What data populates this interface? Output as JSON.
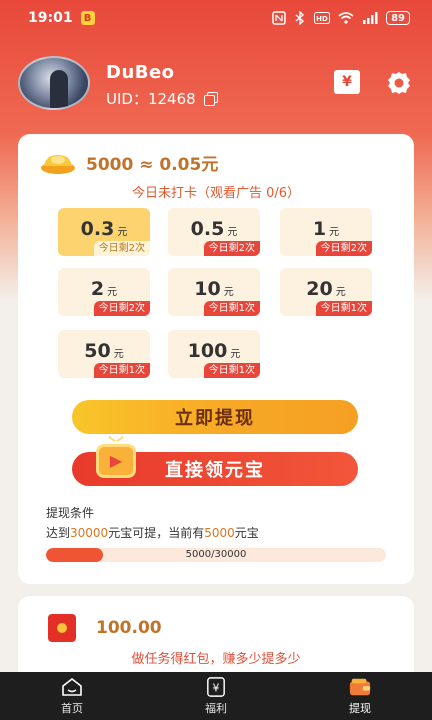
{
  "status_bar": {
    "time": "19:01",
    "notification_badge": "B",
    "battery": "89"
  },
  "profile": {
    "username": "DuBeo",
    "uid_label": "UID：",
    "uid_value": "12468"
  },
  "header_icons": {
    "wallet": "¥",
    "settings": "gear-icon"
  },
  "withdraw": {
    "rate": "5000 ≈ 0.05元",
    "checkin_status": "今日未打卡（观看广告 0/6）",
    "unit": "元",
    "options": [
      {
        "amount": "0.3",
        "remaining": "今日剩2次",
        "selected": true
      },
      {
        "amount": "0.5",
        "remaining": "今日剩2次",
        "selected": false
      },
      {
        "amount": "1",
        "remaining": "今日剩2次",
        "selected": false
      },
      {
        "amount": "2",
        "remaining": "今日剩2次",
        "selected": false
      },
      {
        "amount": "10",
        "remaining": "今日剩1次",
        "selected": false
      },
      {
        "amount": "20",
        "remaining": "今日剩1次",
        "selected": false
      },
      {
        "amount": "50",
        "remaining": "今日剩1次",
        "selected": false
      },
      {
        "amount": "100",
        "remaining": "今日剩1次",
        "selected": false
      }
    ],
    "withdraw_button": "立即提现",
    "get_ingot_button": "直接领元宝",
    "condition_title": "提现条件",
    "condition_prefix": "达到",
    "condition_target": "30000",
    "condition_middle": "元宝可提，当前有",
    "condition_current": "5000",
    "condition_suffix": "元宝",
    "progress_text": "5000/30000",
    "progress_fraction": 0.1667
  },
  "red_packet": {
    "amount": "100.00",
    "description": "做任务得红包，赚多少提多少"
  },
  "tabs": [
    {
      "label": "首页",
      "icon": "home-icon",
      "active": false
    },
    {
      "label": "福利",
      "icon": "yen-icon",
      "active": false
    },
    {
      "label": "提现",
      "icon": "wallet-icon",
      "active": true
    }
  ],
  "colors": {
    "brand_red": "#e8483a",
    "gold": "#f7a826",
    "accent_text": "#c2732a"
  }
}
